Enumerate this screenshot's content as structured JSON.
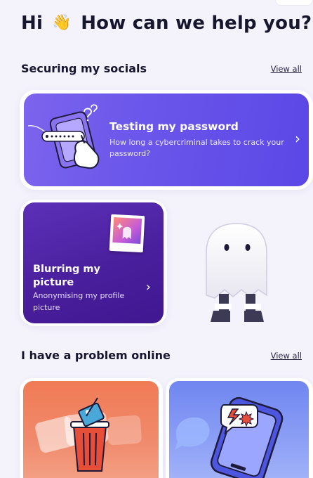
{
  "header": {
    "greeting_prefix": "Hi",
    "greeting_suffix": "How can we help you?",
    "wave_emoji": "👋"
  },
  "section_socials": {
    "title": "Securing my socials",
    "view_all": "View all"
  },
  "card_password": {
    "title": "Testing my password",
    "description": "How long a cybercriminal takes to crack your password?",
    "icon": "chevron-right-icon"
  },
  "card_blur": {
    "title": "Blurring my picture",
    "description": "Anonymising my profile picture",
    "icon": "chevron-right-icon"
  },
  "section_problem": {
    "title": "I have a problem online",
    "view_all": "View all"
  },
  "chevron": "›",
  "colors": {
    "background": "#f4f2fb",
    "password_card": "#6c58ea",
    "blur_card": "#4a1f9d",
    "bin_card": "#f07b55",
    "phone_card": "#7d8ff2",
    "text_dark": "#17162f"
  }
}
